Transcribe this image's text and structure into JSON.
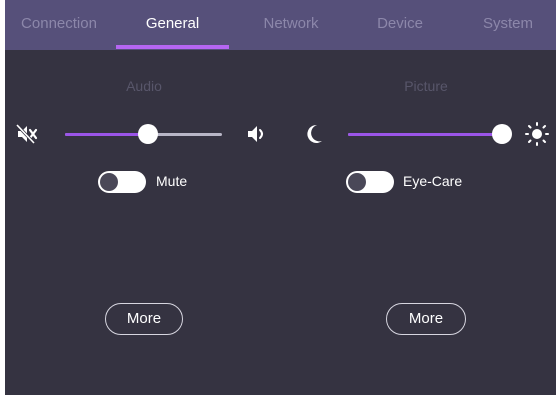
{
  "tabs": [
    {
      "label": "Connection",
      "active": false
    },
    {
      "label": "General",
      "active": true
    },
    {
      "label": "Network",
      "active": false
    },
    {
      "label": "Device",
      "active": false
    },
    {
      "label": "System",
      "active": false
    }
  ],
  "audio": {
    "title": "Audio",
    "volume_level": 0.53,
    "mute_label": "Mute",
    "mute_on": false,
    "more_label": "More"
  },
  "picture": {
    "title": "Picture",
    "brightness_level": 1.0,
    "eyecare_label": "Eye-Care",
    "eyecare_on": false,
    "more_label": "More"
  },
  "icons": {
    "volume_low": "speaker-muted-icon",
    "volume_high": "speaker-loud-icon",
    "brightness_low": "moon-icon",
    "brightness_high": "sun-icon"
  },
  "colors": {
    "background": "#353341",
    "tab_bar": "#56507a",
    "accent": "#9b55e8",
    "tab_inactive": "#8c87aa"
  }
}
